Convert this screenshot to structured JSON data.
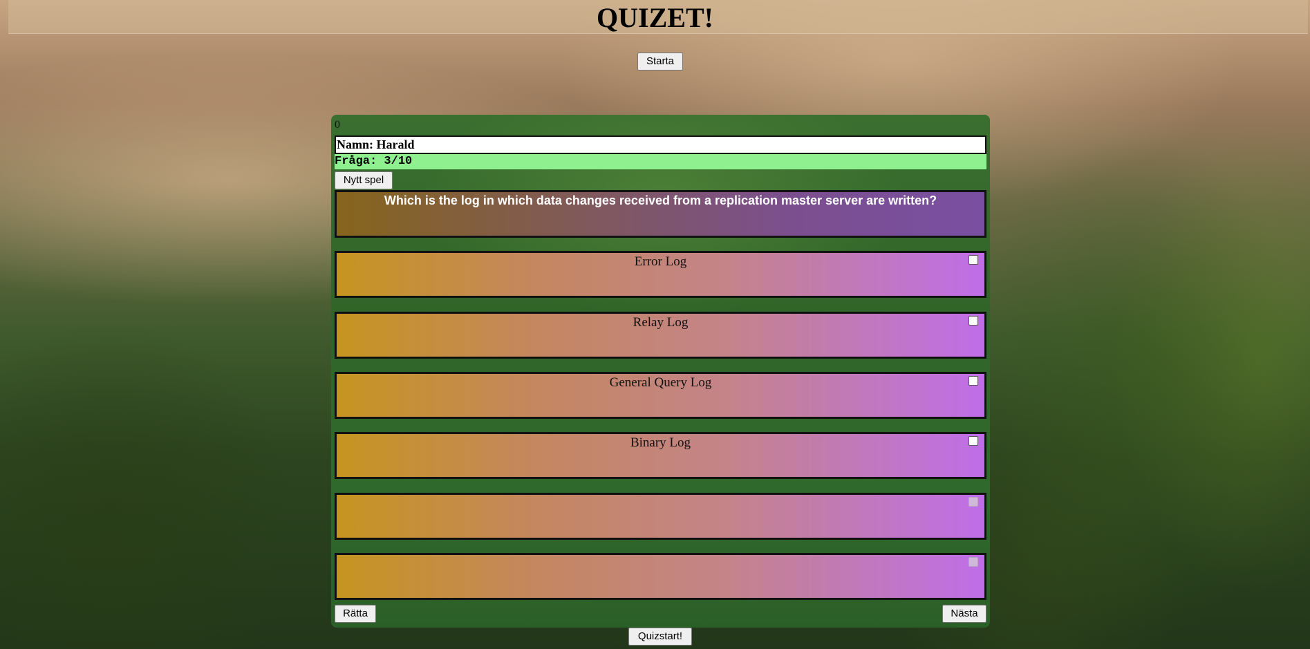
{
  "header": {
    "title": "QUIZET!"
  },
  "controls": {
    "start_label": "Starta",
    "quizstart_label": "Quizstart!"
  },
  "quiz": {
    "score": "0",
    "name": "Namn: Harald",
    "question_counter": "Fråga: 3/10",
    "new_game_label": "Nytt spel",
    "question": "Which is the log in which data changes received from a replication master server are written?",
    "answers": [
      {
        "label": "Error Log",
        "enabled": true
      },
      {
        "label": "Relay Log",
        "enabled": true
      },
      {
        "label": "General Query Log",
        "enabled": true
      },
      {
        "label": "Binary Log",
        "enabled": true
      },
      {
        "label": "",
        "enabled": false
      },
      {
        "label": "",
        "enabled": false
      }
    ],
    "check_label": "Rätta",
    "next_label": "Nästa"
  },
  "colors": {
    "panel": "#2f6a2b",
    "counter_bg": "#8ff08f",
    "answer_gradient_start": "#c69520",
    "answer_gradient_end": "#bf6ee8"
  }
}
